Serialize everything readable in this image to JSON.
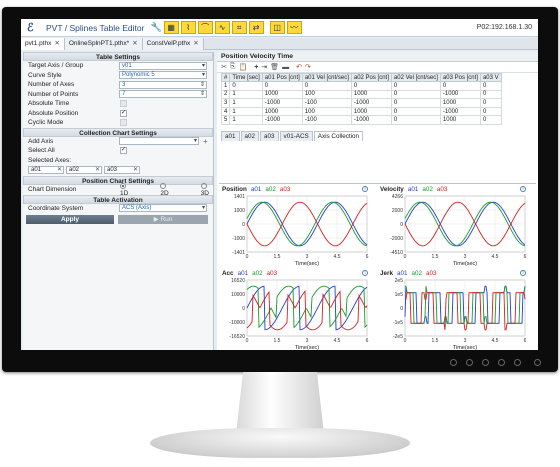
{
  "app": {
    "title": "PVT / Splines Table Editor",
    "ip": "P02:192.168.1.30"
  },
  "file_tabs": [
    "pvt1.pthx",
    "OnlineSplnPT1.pthx*",
    "ConstVelP.pthx"
  ],
  "table_settings": {
    "header": "Table Settings",
    "rows": [
      {
        "label": "Target Axis / Group",
        "value": "v01"
      },
      {
        "label": "Curve Style",
        "value": "Polynomic 5"
      },
      {
        "label": "Number of Axes",
        "value": "3"
      },
      {
        "label": "Number of Points",
        "value": "7"
      }
    ],
    "checks": [
      {
        "label": "Absolute Time",
        "checked": false,
        "disabled": true
      },
      {
        "label": "Absolute Position",
        "checked": true,
        "disabled": false
      },
      {
        "label": "Cyclic Mode",
        "checked": false,
        "disabled": true
      }
    ]
  },
  "collection_settings": {
    "header": "Collection Chart Settings",
    "add_axis": "Add Axis",
    "select_all": "Select All",
    "selected_axes": "Selected Axes:",
    "axes": [
      "a01",
      "a02",
      "a03"
    ]
  },
  "position_settings": {
    "header": "Position Chart Settings",
    "dimension_label": "Chart Dimension",
    "options": [
      "1D",
      "2D",
      "3D"
    ]
  },
  "activation": {
    "header": "Table Activation",
    "coord_label": "Coordinate System",
    "coord_value": "ACS (Axis)",
    "apply": "Apply",
    "run": "Run"
  },
  "pvt_table": {
    "title": "Position Velocity Time",
    "columns": [
      "#",
      "Time [sec]",
      "a01 Pos [cnt]",
      "a01 Vel [cnt/sec]",
      "a02 Pos [cnt]",
      "a02 Vel [cnt/sec]",
      "a03 Pos [cnt]",
      "a03 V"
    ],
    "rows": [
      [
        "1",
        "0",
        "0",
        "0",
        "0",
        "0",
        "0",
        "0"
      ],
      [
        "2",
        "1",
        "1000",
        "100",
        "1000",
        "0",
        "-1000",
        "0"
      ],
      [
        "3",
        "1",
        "-1000",
        "-100",
        "-1000",
        "0",
        "1000",
        "0"
      ],
      [
        "4",
        "1",
        "1000",
        "100",
        "1000",
        "0",
        "-1000",
        "0"
      ],
      [
        "5",
        "1",
        "-1000",
        "-100",
        "-1000",
        "0",
        "1000",
        "0"
      ]
    ]
  },
  "plot_tabs": [
    "a01",
    "a02",
    "a03",
    "v01-ACS",
    "Axis Collection"
  ],
  "series_colors": {
    "a01": "#1f3fd0",
    "a02": "#1a9a2a",
    "a03": "#d42020"
  },
  "chart_data": [
    {
      "type": "line",
      "title": "Position",
      "x": [
        0,
        1.5,
        3.0,
        4.5,
        6.0
      ],
      "ylim": [
        -1401,
        1401
      ],
      "yticks": [
        "1401",
        "1000",
        "0",
        "-1000",
        "-1401"
      ],
      "xlabel": "Time(sec)",
      "series": [
        {
          "name": "a01"
        },
        {
          "name": "a02"
        },
        {
          "name": "a03"
        }
      ]
    },
    {
      "type": "line",
      "title": "Velocity",
      "x": [
        0,
        1.5,
        3.0,
        4.5,
        6.0
      ],
      "ylim": [
        -4510,
        4266
      ],
      "yticks": [
        "4266",
        "2000",
        "0",
        "-2000",
        "-4510"
      ],
      "xlabel": "Time(sec)",
      "series": [
        {
          "name": "a01"
        },
        {
          "name": "a02"
        },
        {
          "name": "a03"
        }
      ]
    },
    {
      "type": "line",
      "title": "Acc",
      "x": [
        0,
        1.5,
        3.0,
        4.5,
        6.0
      ],
      "ylim": [
        -16520,
        16520
      ],
      "yticks": [
        "16520",
        "10000",
        "0",
        "-10000",
        "-16520"
      ],
      "xlabel": "Time(sec)",
      "series": [
        {
          "name": "a01"
        },
        {
          "name": "a02"
        },
        {
          "name": "a03"
        }
      ]
    },
    {
      "type": "line",
      "title": "Jerk",
      "x": [
        0,
        1.5,
        3.0,
        4.5,
        6.0
      ],
      "ylim": [
        -10000,
        10000
      ],
      "yticks": [
        "2e5",
        "1e5",
        "0",
        "-1e5",
        "-2e5"
      ],
      "xlabel": "Time(sec)",
      "series": [
        {
          "name": "a01"
        },
        {
          "name": "a02"
        },
        {
          "name": "a03"
        }
      ]
    }
  ]
}
